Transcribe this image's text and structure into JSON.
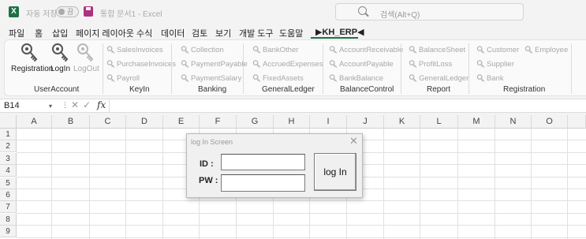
{
  "titlebar": {
    "app_icon_letter": "X",
    "autosave_label": "자동 저장",
    "autosave_state": "끔",
    "document": "통합 문서1  -  Excel",
    "search_placeholder": "검색(Alt+Q)"
  },
  "tabs": [
    {
      "label": "파일"
    },
    {
      "label": "홈"
    },
    {
      "label": "삽입"
    },
    {
      "label": "페이지 레이아웃"
    },
    {
      "label": "수식"
    },
    {
      "label": "데이터"
    },
    {
      "label": "검토"
    },
    {
      "label": "보기"
    },
    {
      "label": "개발 도구"
    },
    {
      "label": "도움말"
    },
    {
      "label": "▶KH_ERP◀",
      "active": true
    }
  ],
  "ribbon": {
    "user_account": {
      "title": "UserAccount",
      "registration": "Registration",
      "login": "LogIn",
      "logout": "LogOut"
    },
    "keyin": {
      "title": "KeyIn",
      "items": [
        "SalesInvoices",
        "PurchaseInvoices",
        "Payroll"
      ]
    },
    "banking": {
      "title": "Banking",
      "items": [
        "Collection",
        "PaymentPayable",
        "PaymentSalary"
      ]
    },
    "general_ledger": {
      "title": "GeneralLedger",
      "items": [
        "BankOther",
        "AccruedExpenses",
        "FixedAssets"
      ]
    },
    "balance_control": {
      "title": "BalanceControl",
      "items": [
        "AccountReceivable",
        "AccountPayable",
        "BankBalance"
      ]
    },
    "report": {
      "title": "Report",
      "items": [
        "BalanceSheet",
        "ProfitLoss",
        "GeneralLedger"
      ]
    },
    "registration": {
      "title": "Registration",
      "items": [
        "Customer",
        "Employee",
        "Supplier",
        "Bank"
      ]
    }
  },
  "formula_bar": {
    "name_box": "B14",
    "fx": "fx",
    "value": ""
  },
  "grid": {
    "columns": [
      "A",
      "B",
      "C",
      "D",
      "E",
      "F",
      "G",
      "H",
      "I",
      "J",
      "K",
      "L",
      "M",
      "N",
      "O"
    ],
    "rows": [
      "1",
      "2",
      "3",
      "4",
      "5",
      "6",
      "7",
      "8",
      "9"
    ]
  },
  "dialog": {
    "title": "log In Screen",
    "close": "✕",
    "id_label": "ID :",
    "pw_label": "PW :",
    "id_value": "",
    "pw_value": "",
    "login_button": "log In"
  },
  "colors": {
    "excel_green": "#1e7145",
    "disabled_text": "#a8a8a8"
  }
}
